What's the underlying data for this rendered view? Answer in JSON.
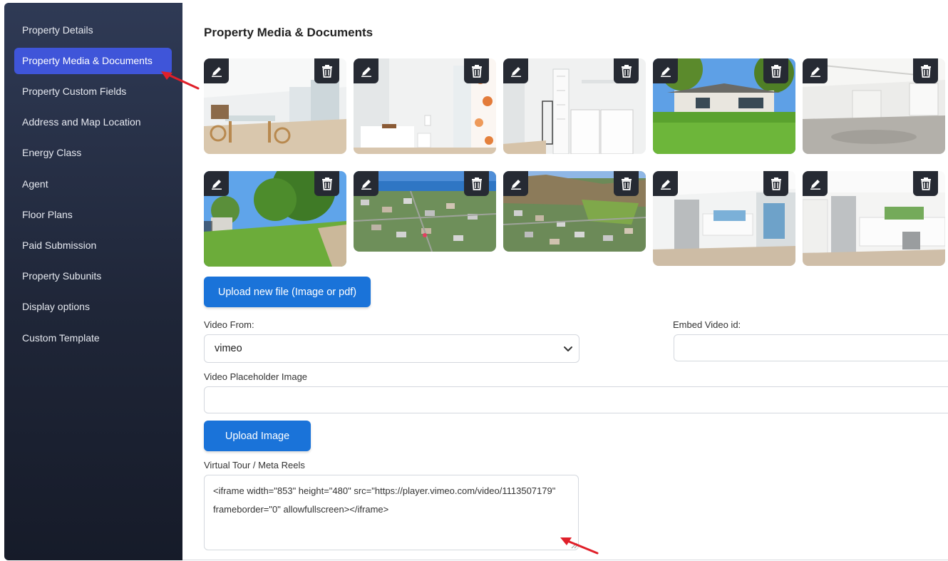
{
  "sidebar": {
    "items": [
      {
        "label": "Property Details"
      },
      {
        "label": "Property Media & Documents",
        "active": true
      },
      {
        "label": "Property Custom Fields"
      },
      {
        "label": "Address and Map Location"
      },
      {
        "label": "Energy Class"
      },
      {
        "label": "Agent"
      },
      {
        "label": "Floor Plans"
      },
      {
        "label": "Paid Submission"
      },
      {
        "label": "Property Subunits"
      },
      {
        "label": "Display options"
      },
      {
        "label": "Custom Template"
      }
    ]
  },
  "main": {
    "title": "Property Media & Documents",
    "gallery": [
      {
        "scene": "living-room-icon"
      },
      {
        "scene": "bathroom-icon"
      },
      {
        "scene": "laundry-room-icon"
      },
      {
        "scene": "backyard-icon"
      },
      {
        "scene": "garage-icon"
      },
      {
        "scene": "garden-icon"
      },
      {
        "scene": "aerial-ocean-icon"
      },
      {
        "scene": "aerial-hill-icon"
      },
      {
        "scene": "kitchen-icon"
      },
      {
        "scene": "kitchen-icon"
      }
    ],
    "upload_file_label": "Upload new file (Image or pdf)",
    "video_from": {
      "label": "Video From:",
      "value": "vimeo"
    },
    "embed_video_id": {
      "label": "Embed Video id:",
      "value": ""
    },
    "video_placeholder": {
      "label": "Video Placeholder Image",
      "value": ""
    },
    "upload_image_label": "Upload Image",
    "virtual_tour": {
      "label": "Virtual Tour / Meta Reels",
      "value": "<iframe width=\"853\" height=\"480\" src=\"https://player.vimeo.com/video/1113507179\" frameborder=\"0\" allowfullscreen></iframe>"
    }
  },
  "colors": {
    "accent": "#3f55d9",
    "button": "#1a73d9",
    "annotation": "#e0202a",
    "sidebar": "#1f2638"
  },
  "icons": {
    "edit": "pencil-icon",
    "delete": "trash-icon",
    "select": "chevron-down-icon"
  }
}
